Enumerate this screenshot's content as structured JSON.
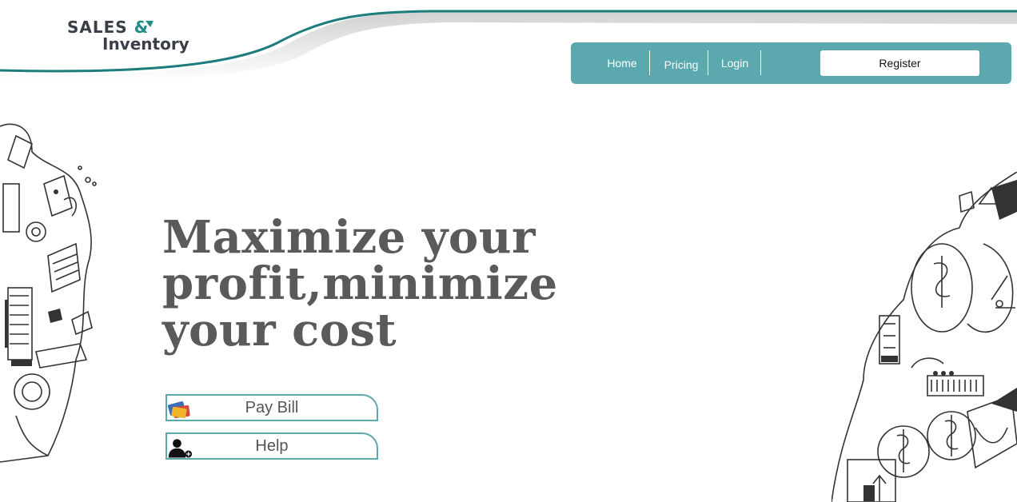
{
  "brand": {
    "line1": "SALES",
    "amp": "&",
    "line2": "Inventory",
    "accent_color": "#1e8b86",
    "text_color": "#3a3f47"
  },
  "nav": {
    "background_color": "#5ba9ae",
    "items": [
      {
        "label": "Home"
      },
      {
        "label": "Pricing"
      },
      {
        "label": "Login"
      }
    ],
    "register_label": "Register"
  },
  "hero": {
    "headline_lines": [
      "Maximize your",
      "profit,minimize",
      "your cost"
    ],
    "text_color": "#5a5a5a"
  },
  "actions": [
    {
      "label": "Pay Bill",
      "icon": "credit-cards-icon"
    },
    {
      "label": "Help",
      "icon": "support-agent-icon"
    }
  ],
  "decor": {
    "left": "business-doodle-left",
    "right": "finance-doodle-right"
  }
}
